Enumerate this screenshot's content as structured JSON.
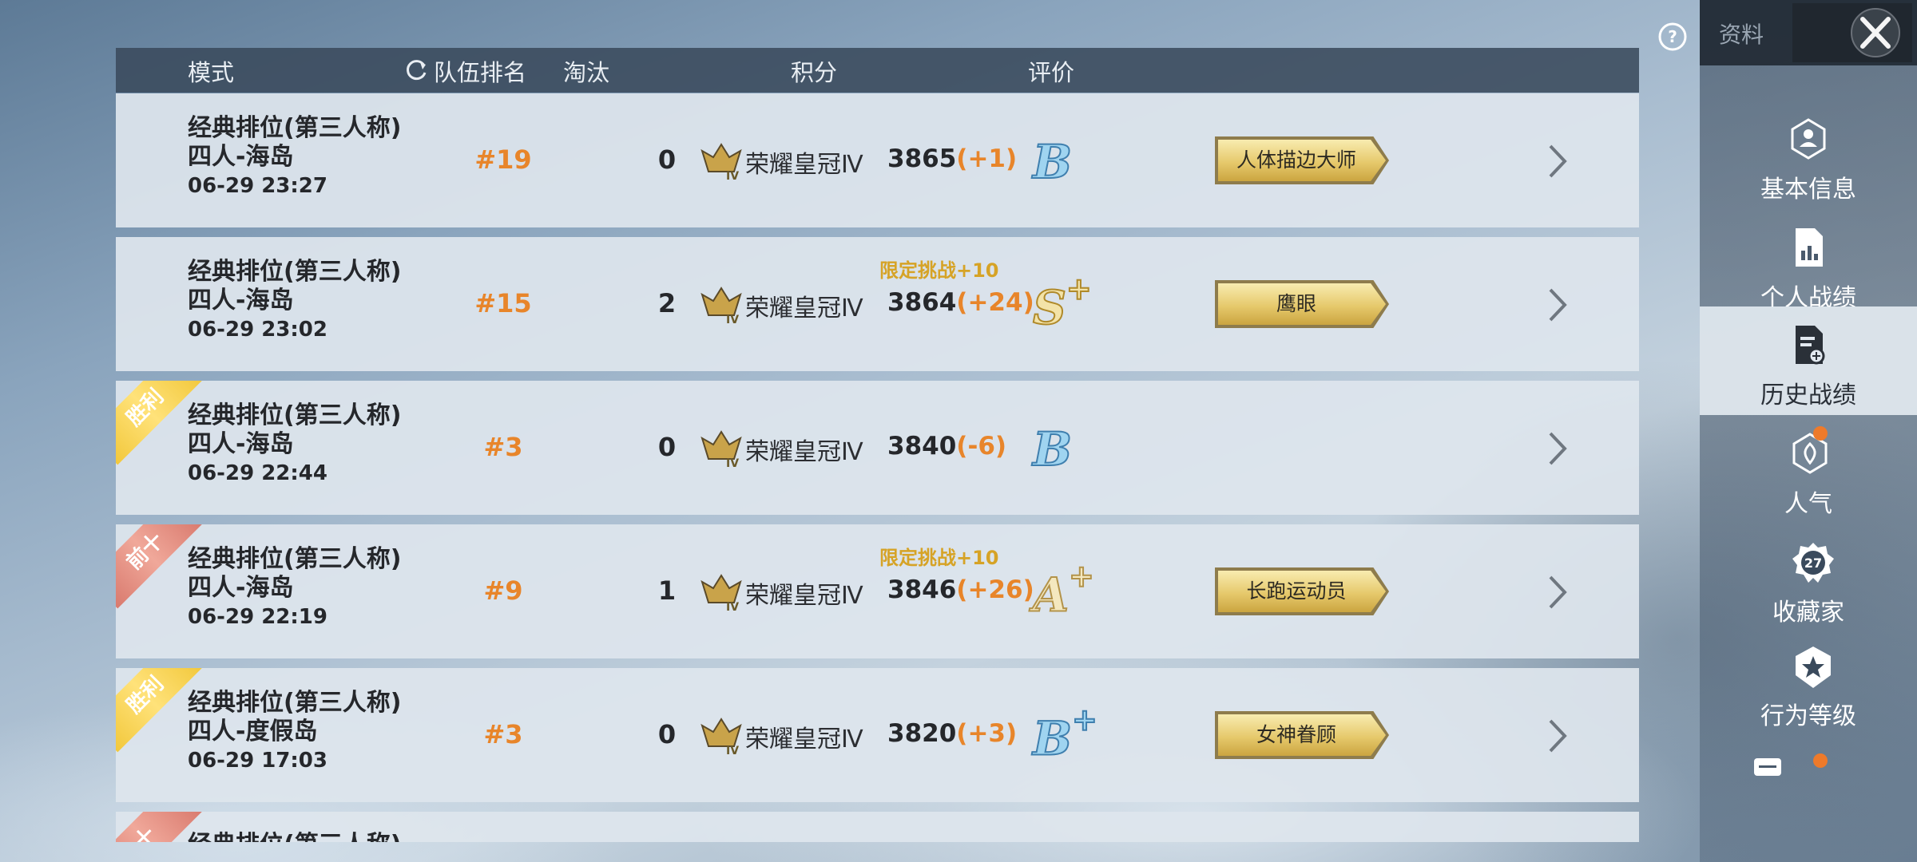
{
  "header": {
    "col_mode": "模式",
    "col_rank": "队伍排名",
    "col_kills": "淘汰",
    "col_score": "积分",
    "col_grade": "评价"
  },
  "rows": [
    {
      "mode_line1": "经典排位(第三人称)",
      "mode_line2": "四人-海岛",
      "date": "06-29 23:27",
      "rank": "#19",
      "kills": "0",
      "tier": "荣耀皇冠Ⅳ",
      "score": "3865",
      "delta": "(+1)",
      "challenge": "",
      "grade": "B",
      "grade_plus": "",
      "title": "人体描边大师",
      "ribbon": ""
    },
    {
      "mode_line1": "经典排位(第三人称)",
      "mode_line2": "四人-海岛",
      "date": "06-29 23:02",
      "rank": "#15",
      "kills": "2",
      "tier": "荣耀皇冠Ⅳ",
      "score": "3864",
      "delta": "(+24)",
      "challenge": "限定挑战+10",
      "grade": "S",
      "grade_plus": "+",
      "title": "鹰眼",
      "ribbon": ""
    },
    {
      "mode_line1": "经典排位(第三人称)",
      "mode_line2": "四人-海岛",
      "date": "06-29 22:44",
      "rank": "#3",
      "kills": "0",
      "tier": "荣耀皇冠Ⅳ",
      "score": "3840",
      "delta": "(-6)",
      "challenge": "",
      "grade": "B",
      "grade_plus": "",
      "title": "",
      "ribbon": "胜利"
    },
    {
      "mode_line1": "经典排位(第三人称)",
      "mode_line2": "四人-海岛",
      "date": "06-29 22:19",
      "rank": "#9",
      "kills": "1",
      "tier": "荣耀皇冠Ⅳ",
      "score": "3846",
      "delta": "(+26)",
      "challenge": "限定挑战+10",
      "grade": "A",
      "grade_plus": "+",
      "title": "长跑运动员",
      "ribbon": "前十"
    },
    {
      "mode_line1": "经典排位(第三人称)",
      "mode_line2": "四人-度假岛",
      "date": "06-29 17:03",
      "rank": "#3",
      "kills": "0",
      "tier": "荣耀皇冠Ⅳ",
      "score": "3820",
      "delta": "(+3)",
      "challenge": "",
      "grade": "B",
      "grade_plus": "+",
      "title": "女神眷顾",
      "ribbon": "胜利"
    },
    {
      "mode_line1": "经典排位(第三人称)",
      "mode_line2": "",
      "date": "",
      "rank": "",
      "kills": "",
      "tier": "",
      "score": "",
      "delta": "",
      "challenge": "",
      "grade": "",
      "grade_plus": "",
      "title": "",
      "ribbon": "十"
    }
  ],
  "sidebar": {
    "title": "资料",
    "items": [
      {
        "label": "基本信息",
        "icon": "profile-icon"
      },
      {
        "label": "个人战绩",
        "icon": "stats-icon"
      },
      {
        "label": "历史战绩",
        "icon": "history-icon"
      },
      {
        "label": "人气",
        "icon": "popularity-icon"
      },
      {
        "label": "收藏家",
        "icon": "collector-icon",
        "badge": "27"
      },
      {
        "label": "行为等级",
        "icon": "behavior-icon"
      }
    ]
  },
  "colors": {
    "accent_orange": "#e8852a",
    "challenge_gold": "#d6a326",
    "header_bg": "#3a4a5c",
    "notify_dot": "#ee7a2a"
  }
}
